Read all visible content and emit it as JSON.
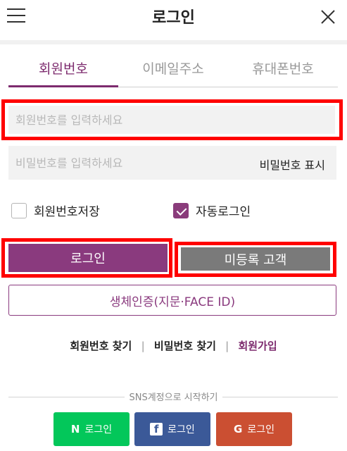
{
  "header": {
    "title": "로그인"
  },
  "tabs": [
    {
      "label": "회원번호",
      "active": true
    },
    {
      "label": "이메일주소",
      "active": false
    },
    {
      "label": "휴대폰번호",
      "active": false
    }
  ],
  "form": {
    "member_placeholder": "회원번호를 입력하세요",
    "password_placeholder": "비밀번호를 입력하세요",
    "show_password_label": "비밀번호 표시",
    "save_member_label": "회원번호저장",
    "save_member_checked": false,
    "auto_login_label": "자동로그인",
    "auto_login_checked": true,
    "login_button": "로그인",
    "guest_button": "미등록 고객",
    "biometric_button": "생체인증(지문·FACE ID)"
  },
  "links": {
    "find_member": "회원번호 찾기",
    "find_password": "비밀번호 찾기",
    "join": "회원가입",
    "separator": "|"
  },
  "sns": {
    "title": "SNS계정으로 시작하기",
    "naver": {
      "icon": "N",
      "label": "로그인"
    },
    "facebook": {
      "icon": "f",
      "label": "로그인"
    },
    "google": {
      "icon": "G",
      "label": "로그인"
    }
  },
  "colors": {
    "accent": "#7d2b6e",
    "highlight": "#ff0000",
    "naver": "#03c75a",
    "facebook": "#3b5998",
    "google": "#cb4f32"
  }
}
